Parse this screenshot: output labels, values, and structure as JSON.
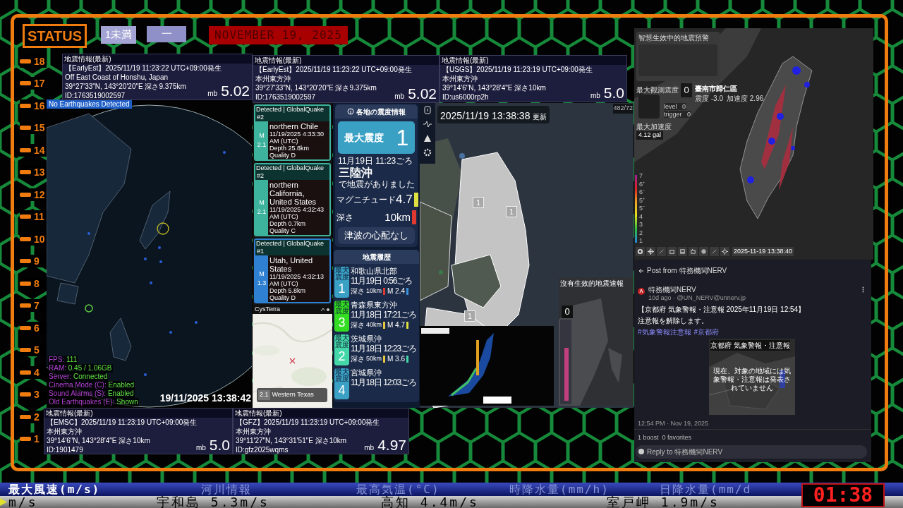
{
  "header": {
    "status": "STATUS",
    "scale_box": "1未満",
    "dash_box": "一",
    "date": "NOVEMBER 19, 2025"
  },
  "ruler": [
    "18",
    "17",
    "16",
    "15",
    "14",
    "13",
    "12",
    "11",
    "10",
    "9",
    "8",
    "7",
    "6",
    "5",
    "4",
    "3",
    "2",
    "1"
  ],
  "quake_cards": [
    {
      "title": "地震情報(最新)",
      "source": "【EarlyEst】2025/11/19  11:23:22  UTC+09:00発生",
      "region": "Off East Coast of Honshu, Japan",
      "coords": "39°27'33\"N,  143°20'20\"E   深さ9.375km",
      "id": "ID:1763519002597",
      "unit": "mb",
      "magnitude": "5.02"
    },
    {
      "title": "地震情報(最新)",
      "source": "【EarlyEst】2025/11/19  11:23:22  UTC+09:00発生",
      "region": "本州東方沖",
      "coords": "39°27'33\"N,  143°20'20\"E   深さ9.375km",
      "id": "ID:1763519002597",
      "unit": "mb",
      "magnitude": "5.02"
    },
    {
      "title": "地震情報(最新)",
      "source": "【USGS】2025/11/19  11:23:19  UTC+09:00発生",
      "region": "本州東方沖",
      "coords": "39°14'6\"N,  143°28'4\"E   深さ10km",
      "id": "ID:us6000rp2h",
      "unit": "mb",
      "magnitude": "5.0"
    },
    {
      "title": "地震情報(最新)",
      "source": "【EMSC】2025/11/19  11:23:19  UTC+09:00発生",
      "region": "本州東方沖",
      "coords": "39°14'6\"N,  143°28'4\"E   深さ10km",
      "id": "ID:1901479",
      "unit": "mb",
      "magnitude": "5.0"
    },
    {
      "title": "地震情報(最新)",
      "source": "【GFZ】2025/11/19  11:23:19  UTC+09:00発生",
      "region": "本州東方沖",
      "coords": "39°11'27\"N,  143°31'51\"E   深さ10km",
      "id": "ID:gfz2025wqms",
      "unit": "mb",
      "magnitude": "4.97"
    }
  ],
  "globe": {
    "banner": "No Earthquakes Detected",
    "stats": [
      {
        "label": "FPS: ",
        "value": "111"
      },
      {
        "label": "RAM: ",
        "value": "0.45 / 1.06GB"
      },
      {
        "label": "Server: ",
        "value": "Connected"
      },
      {
        "label": "Cinema Mode (C): ",
        "value": "Enabled"
      },
      {
        "label": "Sound Alarms (S): ",
        "value": "Enabled"
      },
      {
        "label": "Old Earthquakes (E): ",
        "value": "Shown"
      }
    ],
    "timestamp": "19/11/2025 13:38:42"
  },
  "globalquake": {
    "events": [
      {
        "header": "Detected | GlobalQuake",
        "rank": "#2",
        "m": "M",
        "magnitude": "2.1",
        "place": "northern Chile",
        "time": "11/19/2025 4:33:30 AM (UTC)",
        "depth": "Depth 25.8km",
        "quality": "Quality D",
        "color": "#3db39e"
      },
      {
        "header": "Detected | GlobalQuake",
        "rank": "#2",
        "m": "M",
        "magnitude": "2.1",
        "place": "northern California, United States",
        "time": "11/19/2025 4:32:43 AM (UTC)",
        "depth": "Depth 0.7km",
        "quality": "Quality C",
        "color": "#3db39e"
      },
      {
        "header": "Detected | GlobalQuake",
        "rank": "#1",
        "m": "M",
        "magnitude": "1.3",
        "place": "Utah, United States",
        "time": "11/19/2025 4:32:13 AM (UTC)",
        "depth": "Depth 5.8km",
        "quality": "Quality D",
        "color": "#2f80d0"
      }
    ],
    "brand": "CysTerra",
    "popup": {
      "magnitude": "2.1",
      "place": "Western Texas"
    }
  },
  "intensity": {
    "title": "各地の震度情報",
    "max_label": "最大震度",
    "max_value": "1",
    "time": "11月19日 11:23ごろ",
    "region": "三陸沖",
    "suffix": "で地震がありました",
    "magnitude_label": "マグニチュード",
    "magnitude": "4.7",
    "magnitude_marker": {
      "color": "#e0e040"
    },
    "depth_label": "深さ",
    "depth": "10km",
    "depth_marker": {
      "color": "#e03a30"
    },
    "tsunami": "津波の心配なし"
  },
  "history": {
    "title": "地震履歴",
    "items": [
      {
        "badge": "最大震度",
        "intensity": "1",
        "color": "#3aa0c4",
        "place": "和歌山県北部",
        "time": "11月19日 0:56ごろ",
        "depth_label": "深さ",
        "depth": "10km",
        "depth_marker": {
          "color": "#e03a30"
        },
        "magnitude": "M 2.4",
        "magnitude_marker": {
          "color": "#3a90e0"
        }
      },
      {
        "badge": "最大震度",
        "intensity": "3",
        "color": "#33dd22",
        "place": "青森県東方沖",
        "time": "11月18日 17:21ごろ",
        "depth_label": "深さ",
        "depth": "40km",
        "depth_marker": {
          "color": "#e8c840"
        },
        "magnitude": "M 4.7",
        "magnitude_marker": {
          "color": "#e0e040"
        }
      },
      {
        "badge": "最大震度",
        "intensity": "2",
        "color": "#44d8a8",
        "place": "茨城県沖",
        "time": "11月18日 12:23ごろ",
        "depth_label": "深さ",
        "depth": "50km",
        "depth_marker": {
          "color": "#e8c840"
        },
        "magnitude": "M 3.6",
        "magnitude_marker": {
          "color": "#44d8a8"
        }
      },
      {
        "badge": "最大震度",
        "intensity": "4",
        "color": "#3aa0c4",
        "place": "宮城県沖",
        "time": "11月18日 12:03ごろ"
      }
    ]
  },
  "intensity_map": {
    "updated_time": "2025/11/19 13:38:38",
    "updated_label": "更新",
    "counter": "482/72",
    "markers": [
      "1",
      "1",
      "1"
    ]
  },
  "station_panel": {
    "title": "沒有生效的地震速報",
    "value": "0"
  },
  "taiwan": {
    "title": "智慧生效中的地震預警",
    "max_intensity_label": "最大觀測震度",
    "station_value": "0",
    "station": "臺南市歸仁區",
    "station_intensity": "震度 -3.0",
    "station_accel": "加速度 2.96",
    "station_stats": [
      "level   0",
      "trigger   0"
    ],
    "max_accel_label": "最大加速度",
    "max_accel": "4.12 gal",
    "scale": [
      "7",
      "6⁺",
      "6⁻",
      "5⁺",
      "5⁻",
      "4",
      "3",
      "2",
      "1"
    ],
    "timestamp": "2025-11-19 13:38:40"
  },
  "nerv": {
    "header": "Post from 特務機関NERV",
    "name": "特務機関NERV",
    "handle": "10d ago · @UN_NERV@unnerv.jp",
    "text": "【京都府 気象警報・注意報 2025年11月19日 12:54】",
    "text2": "注意報を解除します。",
    "hashtags": [
      "#気象警報注意報",
      "#京都府"
    ],
    "image_title": "京都府 気象警報・注意報",
    "image_text": "現在、対象の地域には気象警報・注意報は発表されていません",
    "posted": "12:54 PM · Nov 19, 2025",
    "boosts": "1 boost",
    "favorites": "0 favorites",
    "reply_placeholder": "Reply to 特務機関NERV"
  },
  "ticker": {
    "labels": [
      {
        "text": "最大風速(m/s)",
        "highlighted": true
      },
      {
        "text": "河川情報",
        "highlighted": false
      },
      {
        "text": "最高気温(°C)",
        "highlighted": false
      },
      {
        "text": "時降水量(mm/h)",
        "highlighted": false
      },
      {
        "text": "日降水量(mm/d",
        "highlighted": false
      }
    ],
    "values": [
      "m/s",
      "宇和島 5.3m/s",
      "高知 4.4m/s",
      "室戸岬 1.9m/s"
    ],
    "clock": "01:38"
  }
}
